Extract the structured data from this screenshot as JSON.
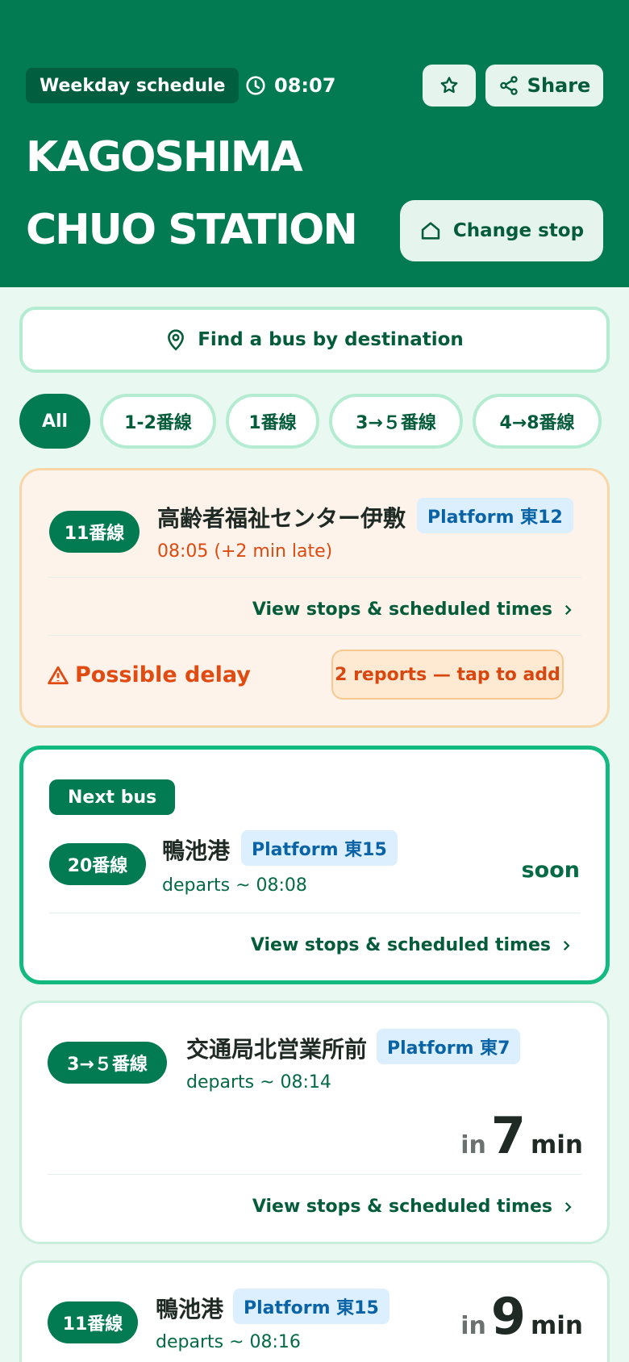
{
  "header": {
    "schedule_label": "Weekday schedule",
    "time": "08:07",
    "share_label": "Share",
    "title_line1": "KAGOSHIMA",
    "title_line2": "CHUO STATION",
    "change_stop_label": "Change stop",
    "background_color": "#027a52"
  },
  "search": {
    "label": "Find a bus by destination"
  },
  "filters": [
    {
      "label": "All",
      "active": true
    },
    {
      "label": "1-2番線",
      "active": false
    },
    {
      "label": "1番線",
      "active": false
    },
    {
      "label": "3→５番線",
      "active": false
    },
    {
      "label": "4→8番線",
      "active": false
    }
  ],
  "departures": [
    {
      "route": "11番線",
      "destination": "高齢者福祉センター伊敷",
      "platform": "Platform 東12",
      "status_text": "08:05 (+2 min late)",
      "view_label": "View stops & scheduled times",
      "delay_label": "Possible delay",
      "reports_label": "2 reports — tap to add"
    },
    {
      "badge": "Next bus",
      "route": "20番線",
      "destination": "鴨池港",
      "platform": "Platform 東15",
      "departs": "departs ~ 08:08",
      "eta_text": "soon",
      "view_label": "View stops & scheduled times"
    },
    {
      "route": "3→５番線",
      "destination": "交通局北営業所前",
      "platform": "Platform 東7",
      "departs": "departs ~ 08:14",
      "eta_prefix": "in",
      "eta_value": "7",
      "eta_unit": "min",
      "view_label": "View stops & scheduled times"
    },
    {
      "route": "11番線",
      "destination": "鴨池港",
      "platform": "Platform 東15",
      "departs": "departs ~ 08:16",
      "eta_prefix": "in",
      "eta_value": "9",
      "eta_unit": "min"
    }
  ],
  "colors": {
    "accent_green": "#027a52",
    "delay_orange": "#e14a10",
    "platform_blue": "#0a63a4",
    "next_border": "#12b980"
  }
}
